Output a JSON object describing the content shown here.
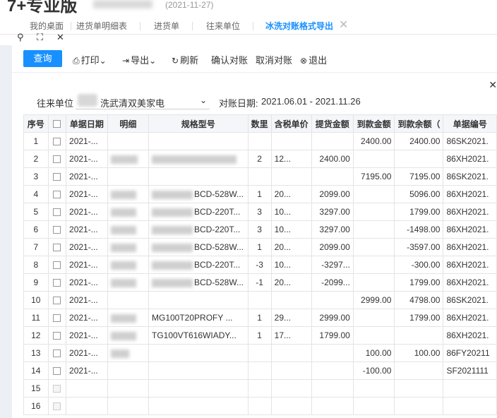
{
  "app": {
    "logo": "7+专业版",
    "date": "(2021-11-27)"
  },
  "tabs": [
    "我的桌面",
    "进货单明细表",
    "进货单",
    "往来单位",
    "冰洗对账格式导出"
  ],
  "mini_tools": {
    "search_glyph": "⚲",
    "expand_glyph": "⛶",
    "close_glyph": "✕"
  },
  "toolbar": {
    "query": "查询",
    "print": "打印",
    "export": "导出",
    "refresh": "刷新",
    "confirm": "确认对账",
    "cancel": "取消对账",
    "exit": "退出",
    "close": "✕"
  },
  "filter": {
    "party_label": "往来单位",
    "party_value": "洗武清双美家电",
    "date_label": "对账日期:",
    "date_value": "2021.06.01 - 2021.11.26"
  },
  "table": {
    "headers": [
      "序号",
      "",
      "单据日期",
      "明细",
      "规格型号",
      "数里",
      "含税单价",
      "提货金额",
      "到款金额",
      "到款余额（",
      "单据编号"
    ],
    "rows": [
      {
        "no": "1",
        "date": "2021-...",
        "spec": "",
        "qty": "",
        "price": "",
        "pick": "",
        "paid": "2400.00",
        "balance": "2400.00",
        "docno": "86SK2021."
      },
      {
        "no": "2",
        "date": "2021-...",
        "spec": "",
        "qty": "2",
        "price": "12...",
        "pick": "2400.00",
        "paid": "",
        "balance": "",
        "docno": "86XH2021."
      },
      {
        "no": "3",
        "date": "2021-...",
        "spec": "",
        "qty": "",
        "price": "",
        "pick": "",
        "paid": "7195.00",
        "balance": "7195.00",
        "docno": "86SK2021."
      },
      {
        "no": "4",
        "date": "2021-...",
        "spec": "BCD-528W...",
        "qty": "1",
        "price": "20...",
        "pick": "2099.00",
        "paid": "",
        "balance": "5096.00",
        "docno": "86XH2021."
      },
      {
        "no": "5",
        "date": "2021-...",
        "spec": "BCD-220T...",
        "qty": "3",
        "price": "10...",
        "pick": "3297.00",
        "paid": "",
        "balance": "1799.00",
        "docno": "86XH2021."
      },
      {
        "no": "6",
        "date": "2021-...",
        "spec": "BCD-220T...",
        "qty": "3",
        "price": "10...",
        "pick": "3297.00",
        "paid": "",
        "balance": "-1498.00",
        "docno": "86XH2021."
      },
      {
        "no": "7",
        "date": "2021-...",
        "spec": "BCD-528W...",
        "qty": "1",
        "price": "20...",
        "pick": "2099.00",
        "paid": "",
        "balance": "-3597.00",
        "docno": "86XH2021."
      },
      {
        "no": "8",
        "date": "2021-...",
        "spec": "BCD-220T...",
        "qty": "-3",
        "price": "10...",
        "pick": "-3297...",
        "paid": "",
        "balance": "-300.00",
        "docno": "86XH2021."
      },
      {
        "no": "9",
        "date": "2021-...",
        "spec": "BCD-528W...",
        "qty": "-1",
        "price": "20...",
        "pick": "-2099...",
        "paid": "",
        "balance": "1799.00",
        "docno": "86XH2021."
      },
      {
        "no": "10",
        "date": "2021-...",
        "spec": "",
        "qty": "",
        "price": "",
        "pick": "",
        "paid": "2999.00",
        "balance": "4798.00",
        "docno": "86SK2021."
      },
      {
        "no": "11",
        "date": "2021-...",
        "spec": "MG100T20PROFY ...",
        "qty": "1",
        "price": "29...",
        "pick": "2999.00",
        "paid": "",
        "balance": "1799.00",
        "docno": "86XH2021."
      },
      {
        "no": "12",
        "date": "2021-...",
        "spec": "TG100VT616WIADY...",
        "qty": "1",
        "price": "17...",
        "pick": "1799.00",
        "paid": "",
        "balance": "",
        "docno": "86XH2021."
      },
      {
        "no": "13",
        "date": "2021-...",
        "spec": "",
        "qty": "",
        "price": "",
        "pick": "",
        "paid": "100.00",
        "balance": "100.00",
        "docno": "86FY20211"
      },
      {
        "no": "14",
        "date": "2021-...",
        "spec": "",
        "qty": "",
        "price": "",
        "pick": "",
        "paid": "-100.00",
        "balance": "",
        "docno": "SF2021111"
      },
      {
        "no": "15",
        "date": "",
        "spec": "",
        "qty": "",
        "price": "",
        "pick": "",
        "paid": "",
        "balance": "",
        "docno": ""
      },
      {
        "no": "16",
        "date": "",
        "spec": "",
        "qty": "",
        "price": "",
        "pick": "",
        "paid": "",
        "balance": "",
        "docno": ""
      }
    ]
  },
  "colors": {
    "accent": "#1890ff",
    "negative": "#e4322b",
    "link": "#1a3ccc"
  }
}
